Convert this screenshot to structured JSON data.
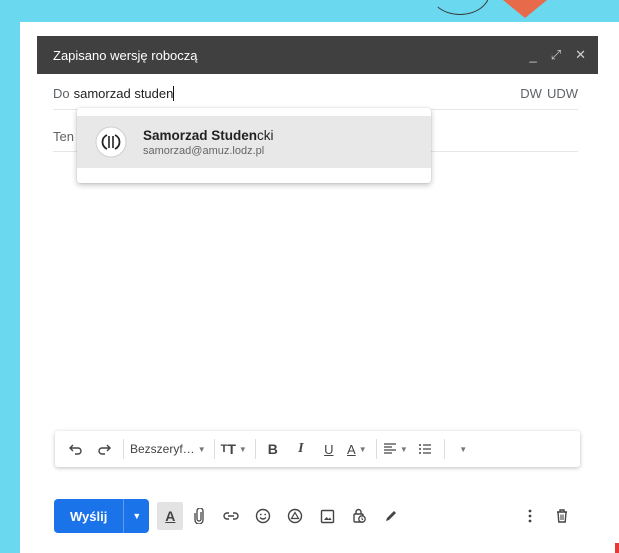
{
  "compose": {
    "title": "Zapisano wersję roboczą",
    "window_controls": {
      "minimize": "_",
      "expand": "⤢",
      "close": "✕"
    }
  },
  "to_field": {
    "label": "Do",
    "value": "samorzad studen",
    "cc": "DW",
    "bcc": "UDW"
  },
  "subject_field": {
    "placeholder_visible": "Ten"
  },
  "suggestion": {
    "name_bold": "Samorzad Studen",
    "name_rest": "cki",
    "email": "samorzad@amuz.lodz.pl"
  },
  "format_toolbar": {
    "font": "Bezszeryf…",
    "bold": "B",
    "italic": "I",
    "underline": "U",
    "text_color": "A"
  },
  "bottom_bar": {
    "send_label": "Wyślij"
  },
  "colors": {
    "background": "#6ad8ee",
    "titlebar": "#404040",
    "send": "#1a73e8",
    "accent_orange": "#e76a4b"
  }
}
